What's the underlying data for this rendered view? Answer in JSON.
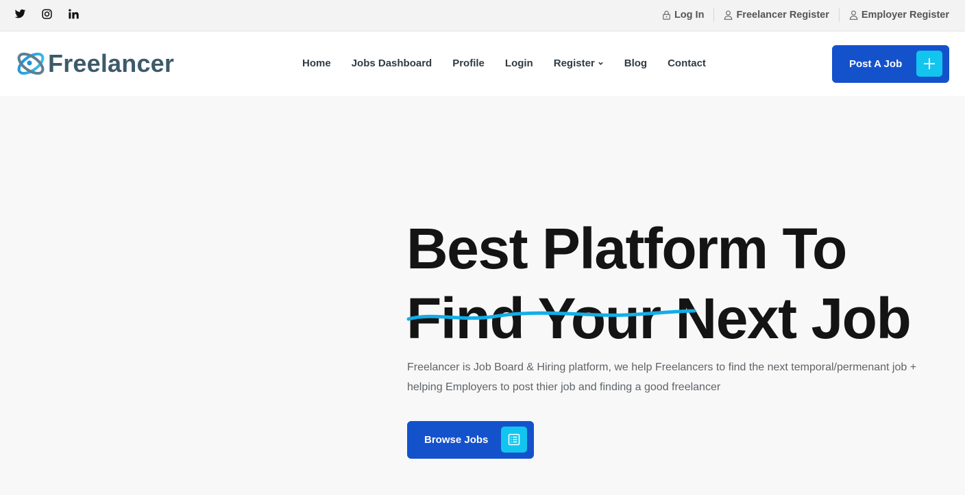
{
  "topbar": {
    "social": [
      {
        "icon": "twitter-icon"
      },
      {
        "icon": "instagram-icon"
      },
      {
        "icon": "linkedin-icon"
      }
    ],
    "links": {
      "login": "Log In",
      "freelancer_register": "Freelancer Register",
      "employer_register": "Employer Register"
    }
  },
  "header": {
    "logo_text": "Freelancer",
    "nav": {
      "home": "Home",
      "jobs_dashboard": "Jobs Dashboard",
      "profile": "Profile",
      "login": "Login",
      "register": "Register",
      "blog": "Blog",
      "contact": "Contact"
    },
    "post_job_label": "Post A Job"
  },
  "hero": {
    "title_line1": "Best Platform To",
    "title_line2": "Find Your Next Job",
    "description": "Freelancer is Job Board & Hiring platform, we help Freelancers to find the next temporal/permenant job + helping Employers to post thier job and finding a good freelancer",
    "browse_label": "Browse Jobs"
  },
  "colors": {
    "primary": "#1452cc",
    "accent": "#12c5ee",
    "logo_text": "#3d5a6b",
    "title": "#141414"
  }
}
